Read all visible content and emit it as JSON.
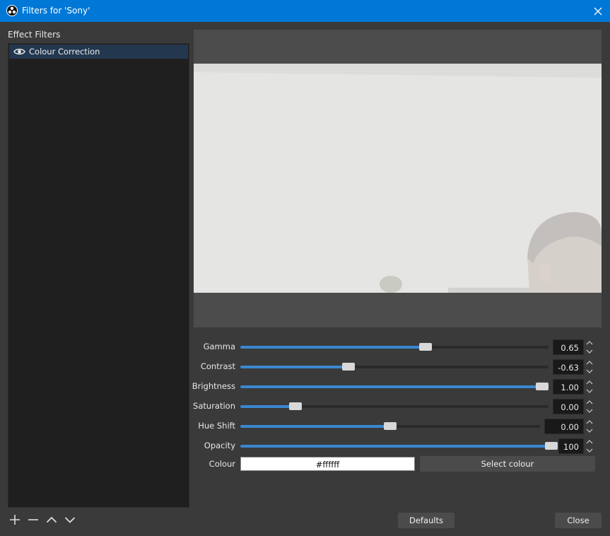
{
  "window": {
    "title": "Filters for 'Sony'"
  },
  "filters_panel": {
    "label": "Effect Filters",
    "items": [
      {
        "name": "Colour Correction",
        "visible": true
      }
    ],
    "toolbar_icons": [
      "add-icon",
      "remove-icon",
      "move-up-icon",
      "move-down-icon"
    ]
  },
  "properties": {
    "gamma": {
      "label": "Gamma",
      "value": "0.65",
      "level": 0.6
    },
    "contrast": {
      "label": "Contrast",
      "value": "-0.63",
      "level": 0.35
    },
    "brightness": {
      "label": "Brightness",
      "value": "1.00",
      "level": 0.98
    },
    "saturation": {
      "label": "Saturation",
      "value": "0.00",
      "level": 0.18
    },
    "hue_shift": {
      "label": "Hue Shift",
      "value": "0.00",
      "level": 0.5
    },
    "opacity": {
      "label": "Opacity",
      "value": "100",
      "level": 0.99
    },
    "colour": {
      "label": "Colour",
      "value": "#ffffff",
      "button": "Select colour"
    }
  },
  "buttons": {
    "defaults": "Defaults",
    "close": "Close"
  },
  "colors": {
    "accent": "#0078d7",
    "slider_fill": "#3a87d0",
    "selection": "#23374f"
  }
}
